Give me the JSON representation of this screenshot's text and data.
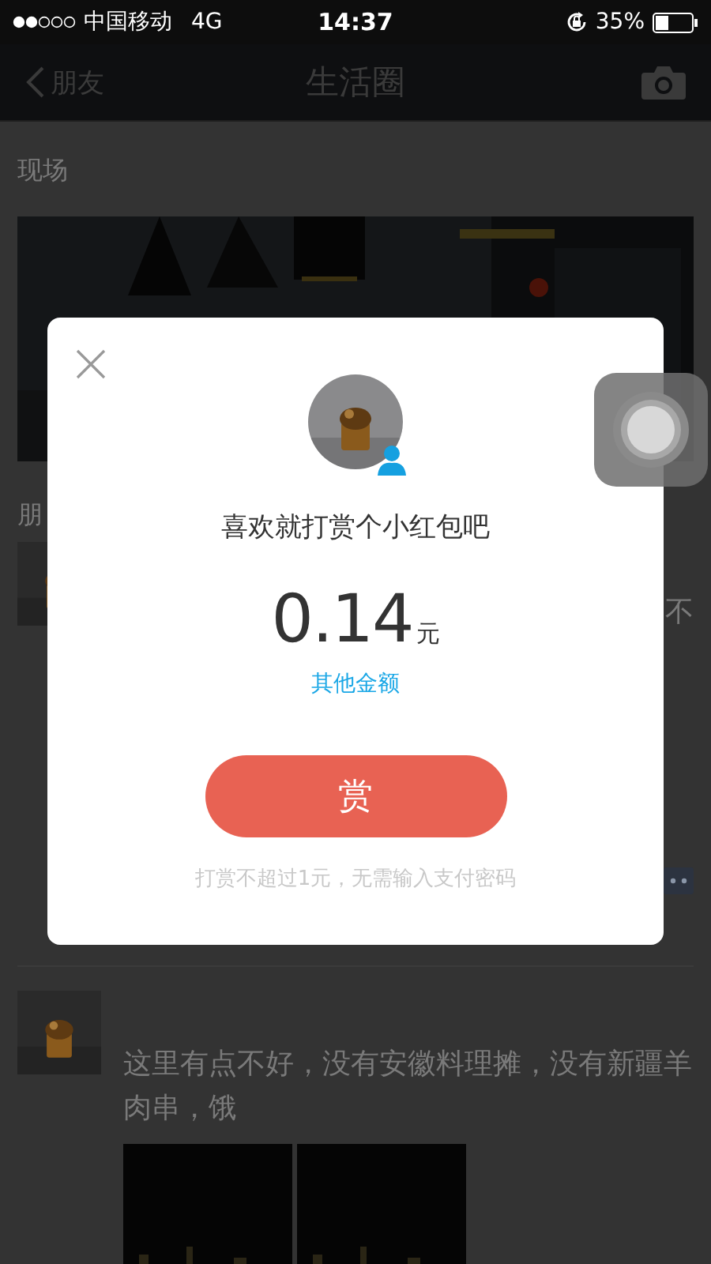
{
  "status_bar": {
    "carrier": "中国移动",
    "network": "4G",
    "time": "14:37",
    "battery": "35%"
  },
  "nav": {
    "back": "朋友",
    "title": "生活圈"
  },
  "feed": {
    "live_label": "现场",
    "friends_label": "朋",
    "posts": [
      {
        "text": "不"
      },
      {
        "text": "这里有点不好，没有安徽料理摊，没有新疆羊肉串，饿"
      }
    ]
  },
  "dialog": {
    "prompt": "喜欢就打赏个小红包吧",
    "amount": "0.14",
    "unit": "元",
    "other_amount": "其他金额",
    "button": "赏",
    "note": "打赏不超过1元，无需输入支付密码"
  }
}
